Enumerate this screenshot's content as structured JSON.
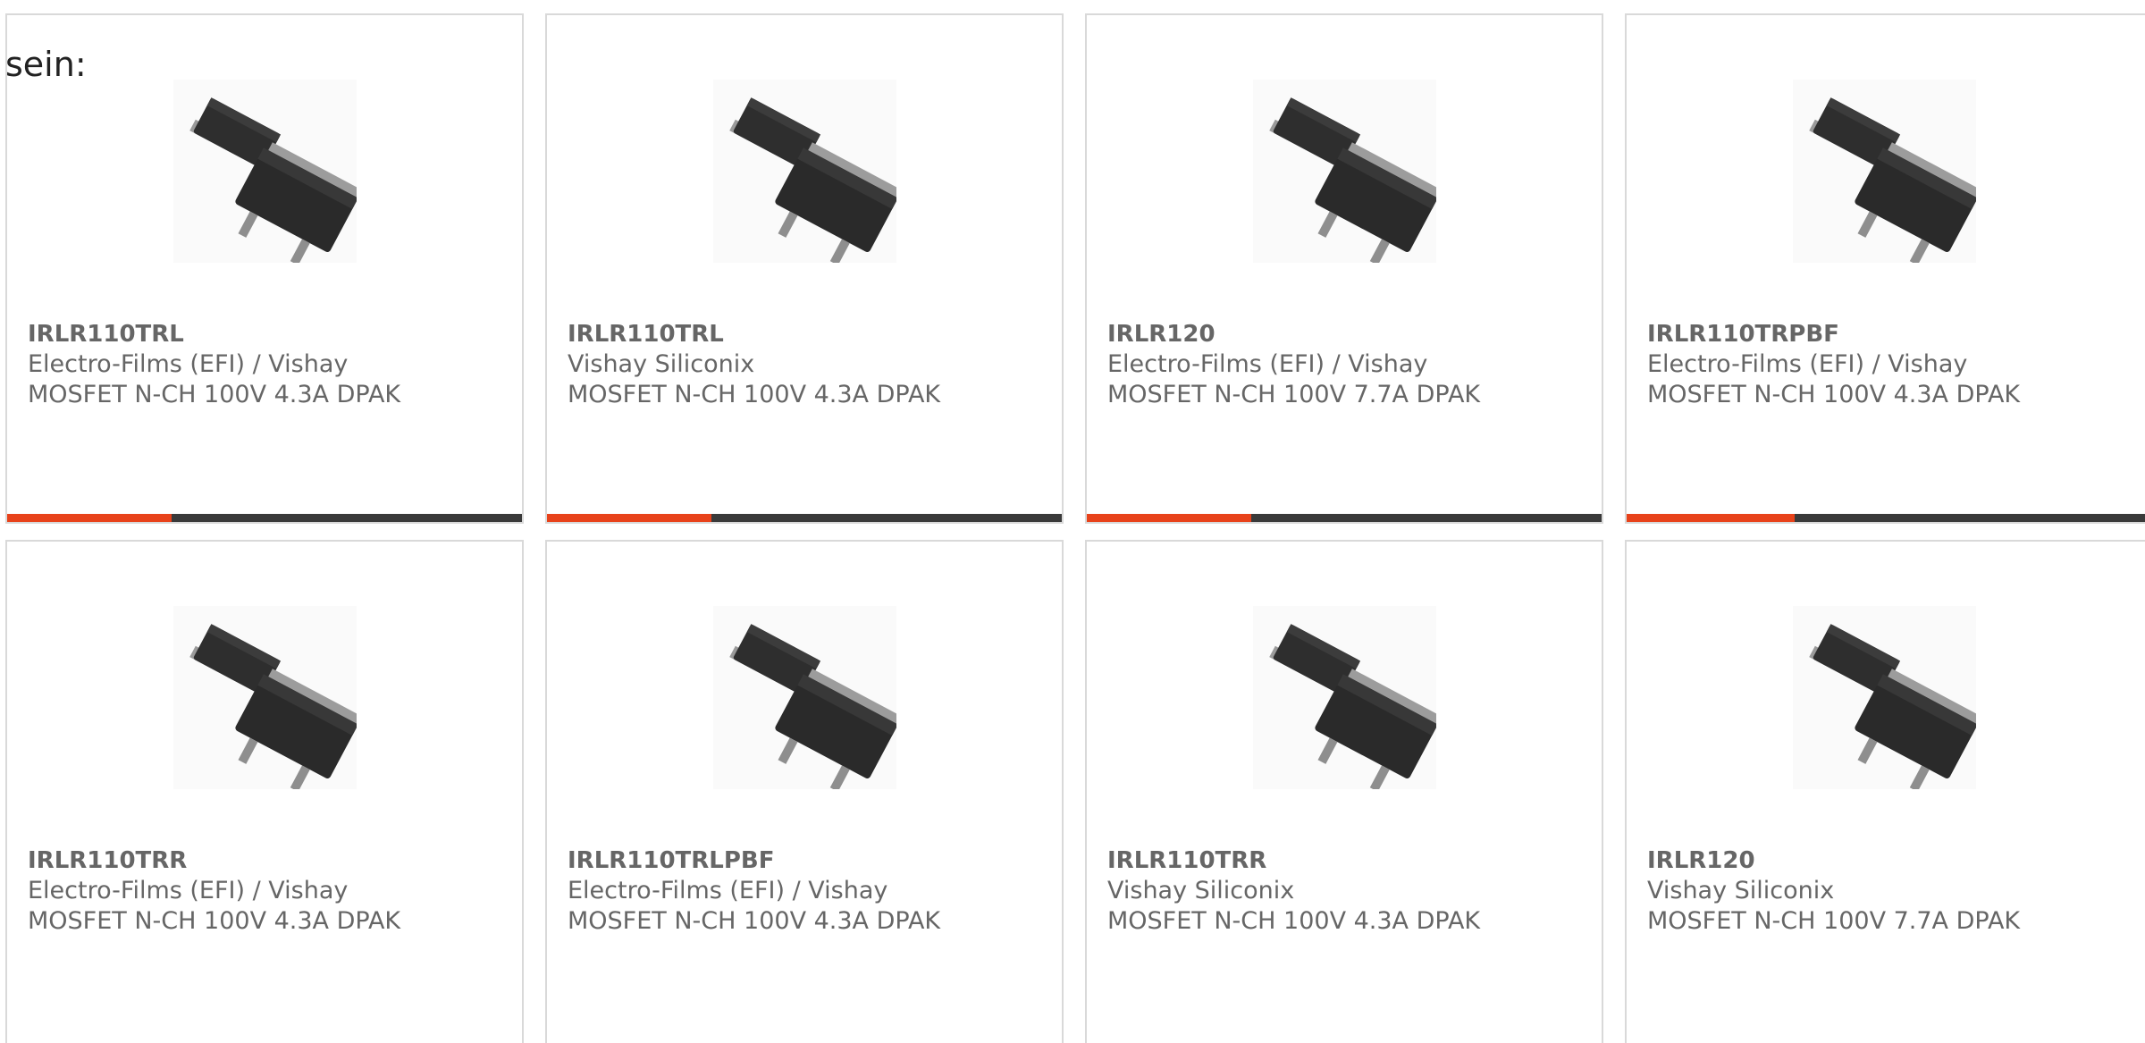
{
  "intro_text": "sein:",
  "colors": {
    "accent": "#e8421a",
    "bar_track": "#3a3a3a",
    "card_border": "#d9d9d9",
    "text": "#666666"
  },
  "products": [
    {
      "part": "IRLR110TRL",
      "manufacturer": "Electro-Films (EFI) / Vishay",
      "description": "MOSFET N-CH 100V 4.3A DPAK",
      "image_icon": "dpak-transistor-icon"
    },
    {
      "part": "IRLR110TRL",
      "manufacturer": "Vishay Siliconix",
      "description": "MOSFET N-CH 100V 4.3A DPAK",
      "image_icon": "dpak-transistor-icon"
    },
    {
      "part": "IRLR120",
      "manufacturer": "Electro-Films (EFI) / Vishay",
      "description": "MOSFET N-CH 100V 7.7A DPAK",
      "image_icon": "dpak-transistor-icon"
    },
    {
      "part": "IRLR110TRPBF",
      "manufacturer": "Electro-Films (EFI) / Vishay",
      "description": "MOSFET N-CH 100V 4.3A DPAK",
      "image_icon": "dpak-transistor-icon"
    },
    {
      "part": "IRLR110TRR",
      "manufacturer": "Electro-Films (EFI) / Vishay",
      "description": "MOSFET N-CH 100V 4.3A DPAK",
      "image_icon": "dpak-transistor-icon"
    },
    {
      "part": "IRLR110TRLPBF",
      "manufacturer": "Electro-Films (EFI) / Vishay",
      "description": "MOSFET N-CH 100V 4.3A DPAK",
      "image_icon": "dpak-transistor-icon"
    },
    {
      "part": "IRLR110TRR",
      "manufacturer": "Vishay Siliconix",
      "description": "MOSFET N-CH 100V 4.3A DPAK",
      "image_icon": "dpak-transistor-icon"
    },
    {
      "part": "IRLR120",
      "manufacturer": "Vishay Siliconix",
      "description": "MOSFET N-CH 100V 7.7A DPAK",
      "image_icon": "dpak-transistor-icon"
    }
  ],
  "row1_bar_progress": 0.32
}
